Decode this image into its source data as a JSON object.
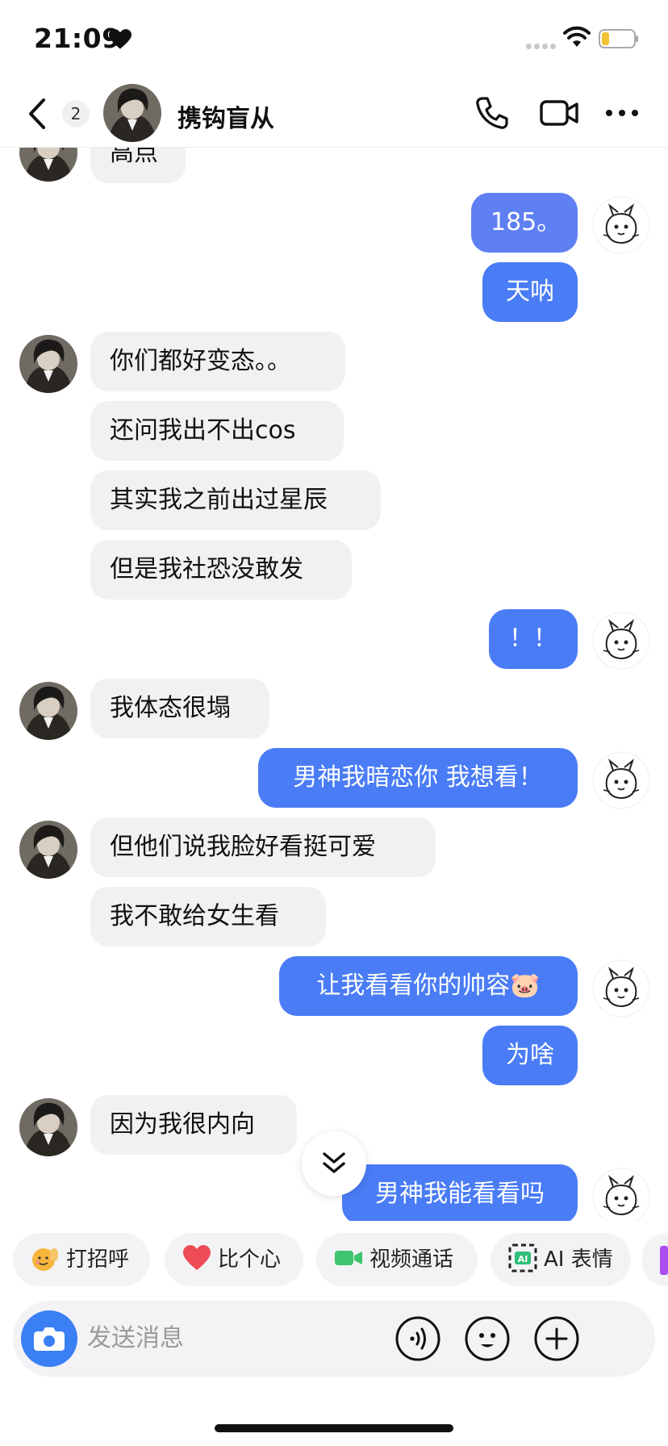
{
  "status_bar": {
    "time": "21:09"
  },
  "header": {
    "unread_count": "2",
    "contact_name": "携钩盲从"
  },
  "messages": [
    {
      "side": "in",
      "text": "高点"
    },
    {
      "side": "out",
      "text": "185。"
    },
    {
      "side": "out",
      "text": "天呐"
    },
    {
      "side": "in",
      "text": "你们都好变态。。"
    },
    {
      "side": "in",
      "text": "还问我出不出cos"
    },
    {
      "side": "in",
      "text": "其实我之前出过星辰"
    },
    {
      "side": "in",
      "text": "但是我社恐没敢发"
    },
    {
      "side": "out",
      "text": "！！"
    },
    {
      "side": "in",
      "text": "我体态很塌"
    },
    {
      "side": "out",
      "text": "男神我暗恋你 我想看！"
    },
    {
      "side": "in",
      "text": "但他们说我脸好看挺可爱"
    },
    {
      "side": "in",
      "text": "我不敢给女生看"
    },
    {
      "side": "out",
      "text": "让我看看你的帅容🐷"
    },
    {
      "side": "out",
      "text": "为啥"
    },
    {
      "side": "in",
      "text": "因为我很内向"
    },
    {
      "side": "out",
      "text": "男神我能看看吗"
    }
  ],
  "quick_actions": [
    {
      "label": "打招呼",
      "icon": "wave-emoji-icon"
    },
    {
      "label": "比个心",
      "icon": "heart-icon"
    },
    {
      "label": "视频通话",
      "icon": "video-call-icon"
    },
    {
      "label": "AI 表情",
      "icon": "ai-sticker-icon"
    }
  ],
  "input": {
    "placeholder": "发送消息"
  },
  "colors": {
    "outgoing_bubble": "#4a7cf6",
    "incoming_bubble": "#f1f1f4",
    "camera_button": "#3b7ff5"
  }
}
